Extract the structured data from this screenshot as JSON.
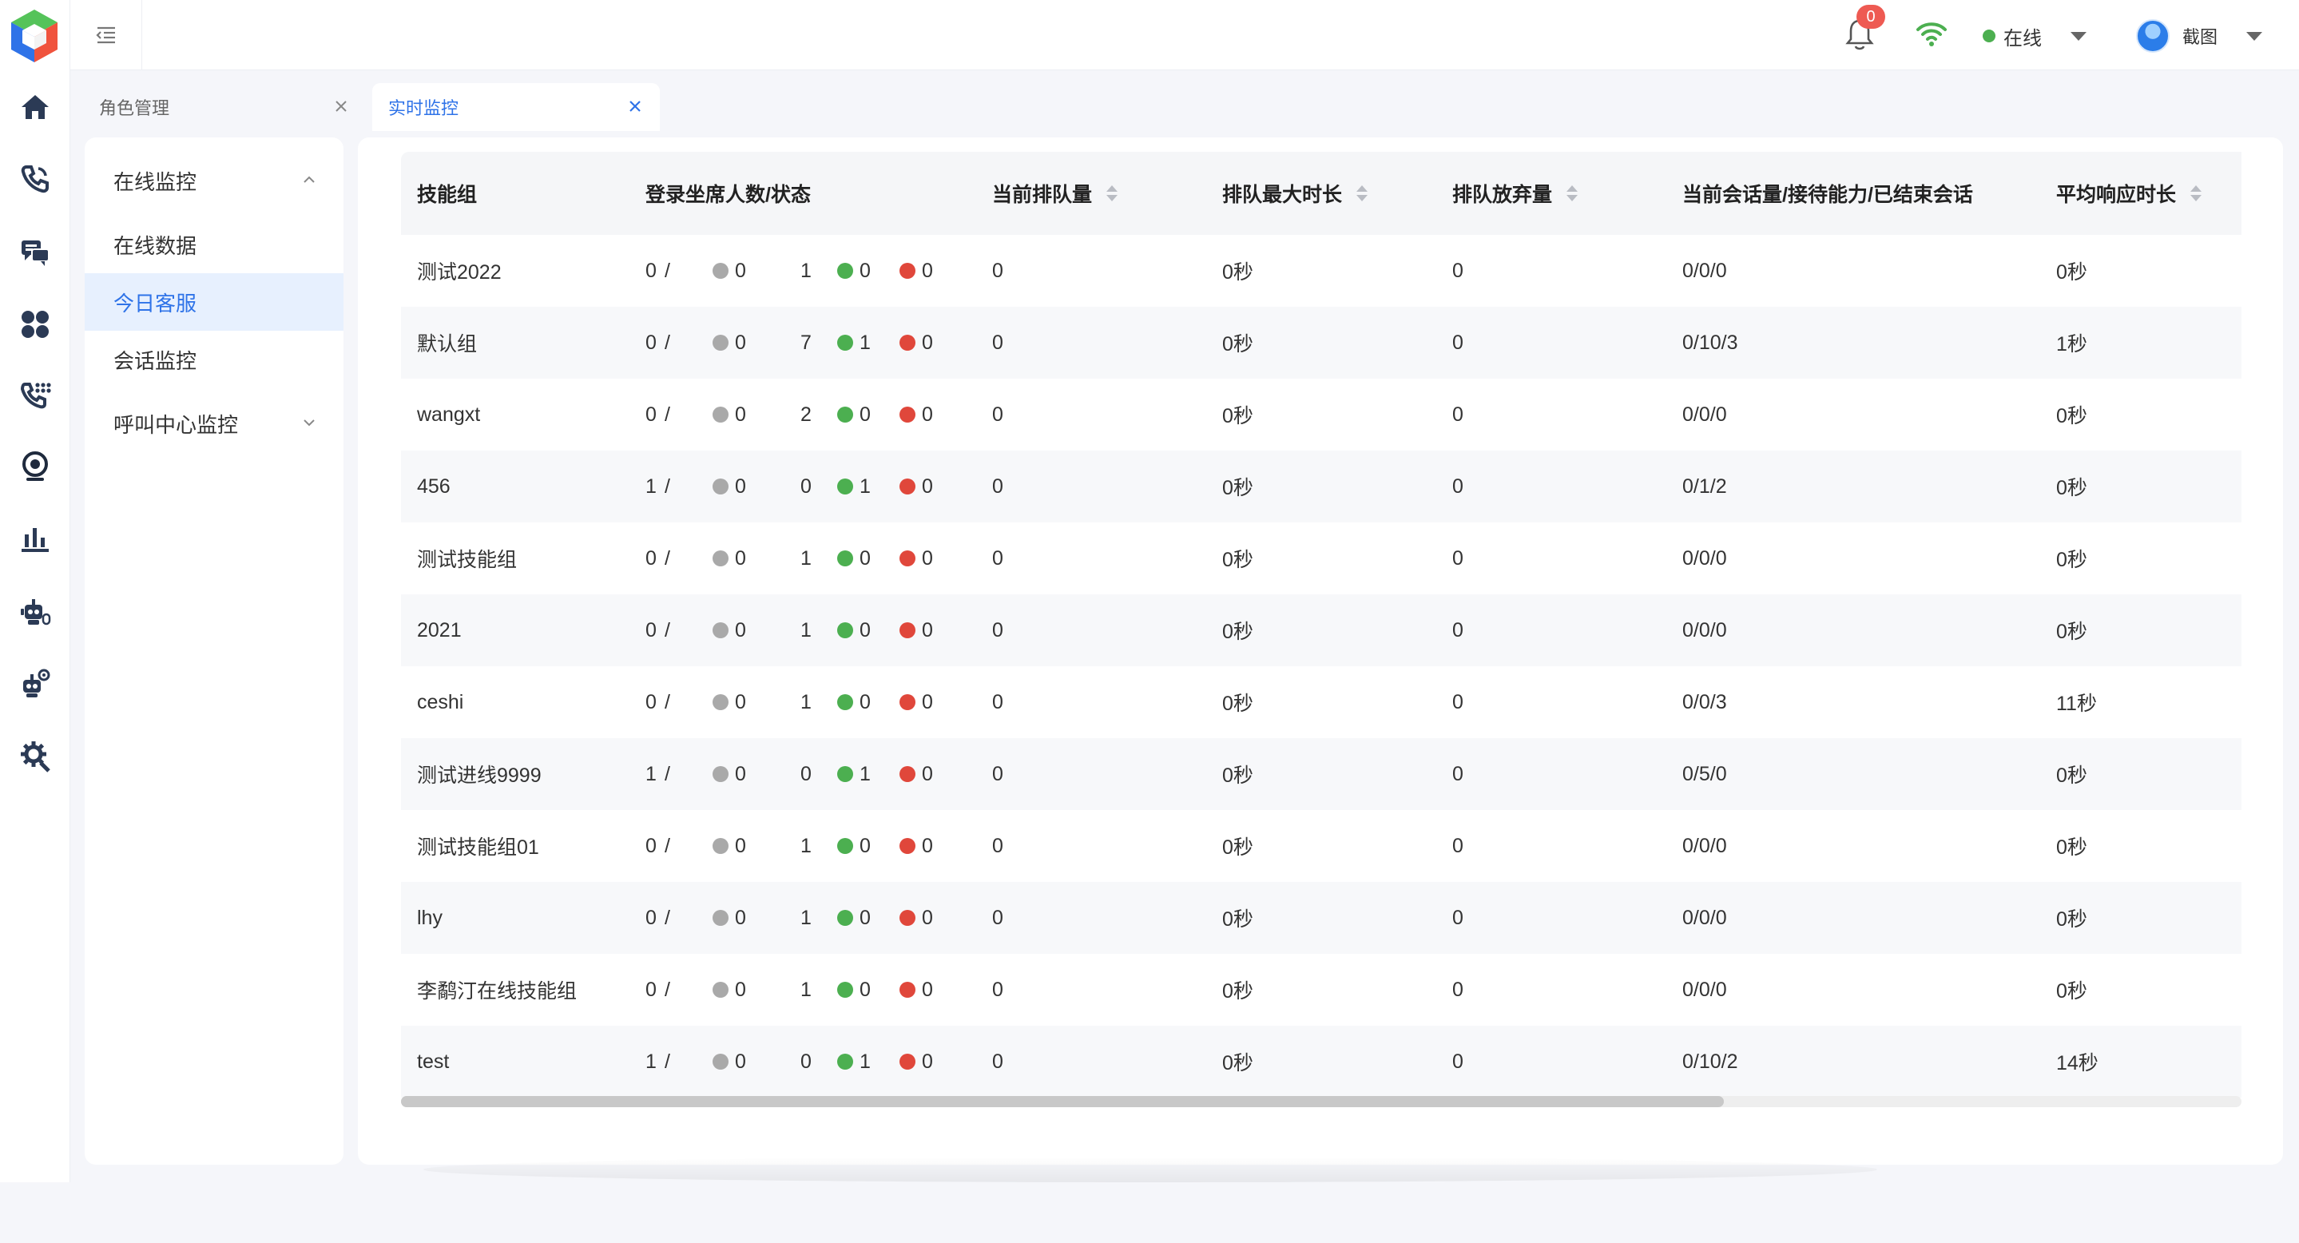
{
  "colors": {
    "accent": "#2f73e8",
    "online_green": "#4caf50",
    "badge_red": "#ee5a52",
    "status_gray": "#a9a9a9",
    "status_green": "#4caf50",
    "status_red": "#e0473b"
  },
  "rail": {
    "icons": [
      "logo-icon",
      "home-icon",
      "phone-call-icon",
      "chat-icon",
      "apps-icon",
      "phone-keypad-icon",
      "monitor-camera-icon",
      "bar-chart-icon",
      "robot-icon",
      "robot-2-icon",
      "settings-gear-icon"
    ]
  },
  "header": {
    "notification_count": "0",
    "status_label": "在线",
    "user_label": "截图"
  },
  "tabs": [
    {
      "label": "角色管理"
    },
    {
      "label": "实时监控"
    }
  ],
  "submenu": {
    "groups": [
      {
        "label": "在线监控",
        "expanded": true,
        "items": [
          {
            "label": "在线数据"
          },
          {
            "label": "今日客服"
          },
          {
            "label": "会话监控"
          }
        ]
      },
      {
        "label": "呼叫中心监控",
        "expanded": false
      }
    ]
  },
  "table": {
    "headers": {
      "group": "技能组",
      "login": "登录坐席人数/状态",
      "queue": "当前排队量",
      "max_queue": "排队最大时长",
      "abandon": "排队放弃量",
      "session": "当前会话量/接待能力/已结束会话",
      "resp": "平均响应时长"
    },
    "rows": [
      {
        "group": "测试2022",
        "login": "0",
        "idle": "0",
        "count": "1",
        "green": "0",
        "red": "0",
        "queue": "0",
        "max_queue": "0秒",
        "abandon": "0",
        "session": "0/0/0",
        "resp": "0秒"
      },
      {
        "group": "默认组",
        "login": "0",
        "idle": "0",
        "count": "7",
        "green": "1",
        "red": "0",
        "queue": "0",
        "max_queue": "0秒",
        "abandon": "0",
        "session": "0/10/3",
        "resp": "1秒"
      },
      {
        "group": "wangxt",
        "login": "0",
        "idle": "0",
        "count": "2",
        "green": "0",
        "red": "0",
        "queue": "0",
        "max_queue": "0秒",
        "abandon": "0",
        "session": "0/0/0",
        "resp": "0秒"
      },
      {
        "group": "456",
        "login": "1",
        "idle": "0",
        "count": "0",
        "green": "1",
        "red": "0",
        "queue": "0",
        "max_queue": "0秒",
        "abandon": "0",
        "session": "0/1/2",
        "resp": "0秒"
      },
      {
        "group": "测试技能组",
        "login": "0",
        "idle": "0",
        "count": "1",
        "green": "0",
        "red": "0",
        "queue": "0",
        "max_queue": "0秒",
        "abandon": "0",
        "session": "0/0/0",
        "resp": "0秒"
      },
      {
        "group": "2021",
        "login": "0",
        "idle": "0",
        "count": "1",
        "green": "0",
        "red": "0",
        "queue": "0",
        "max_queue": "0秒",
        "abandon": "0",
        "session": "0/0/0",
        "resp": "0秒"
      },
      {
        "group": "ceshi",
        "login": "0",
        "idle": "0",
        "count": "1",
        "green": "0",
        "red": "0",
        "queue": "0",
        "max_queue": "0秒",
        "abandon": "0",
        "session": "0/0/3",
        "resp": "11秒"
      },
      {
        "group": "测试进线9999",
        "login": "1",
        "idle": "0",
        "count": "0",
        "green": "1",
        "red": "0",
        "queue": "0",
        "max_queue": "0秒",
        "abandon": "0",
        "session": "0/5/0",
        "resp": "0秒"
      },
      {
        "group": "测试技能组01",
        "login": "0",
        "idle": "0",
        "count": "1",
        "green": "0",
        "red": "0",
        "queue": "0",
        "max_queue": "0秒",
        "abandon": "0",
        "session": "0/0/0",
        "resp": "0秒"
      },
      {
        "group": "lhy",
        "login": "0",
        "idle": "0",
        "count": "1",
        "green": "0",
        "red": "0",
        "queue": "0",
        "max_queue": "0秒",
        "abandon": "0",
        "session": "0/0/0",
        "resp": "0秒"
      },
      {
        "group": "李鹬汀在线技能组",
        "login": "0",
        "idle": "0",
        "count": "1",
        "green": "0",
        "red": "0",
        "queue": "0",
        "max_queue": "0秒",
        "abandon": "0",
        "session": "0/0/0",
        "resp": "0秒"
      },
      {
        "group": "test",
        "login": "1",
        "idle": "0",
        "count": "0",
        "green": "1",
        "red": "0",
        "queue": "0",
        "max_queue": "0秒",
        "abandon": "0",
        "session": "0/10/2",
        "resp": "14秒"
      }
    ]
  }
}
